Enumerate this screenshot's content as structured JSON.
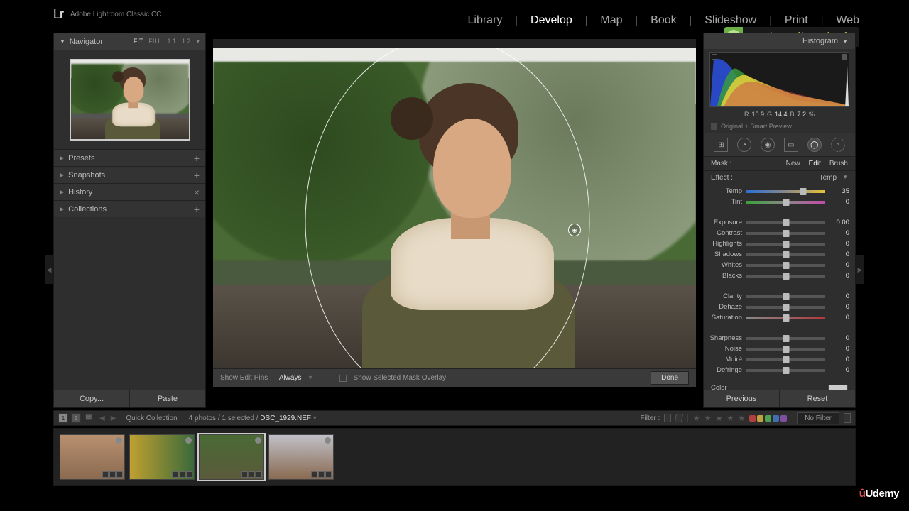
{
  "app": {
    "logo": "Lr",
    "name": "Adobe Lightroom Classic CC"
  },
  "modules": {
    "items": [
      "Library",
      "Develop",
      "Map",
      "Book",
      "Slideshow",
      "Print",
      "Web"
    ],
    "active": "Develop"
  },
  "badge": {
    "letter": "C",
    "text": "creative online school",
    "sub": "creativeonlineschool.org"
  },
  "left": {
    "navigator": "Navigator",
    "navopts": [
      "FIT",
      "FILL",
      "1:1",
      "1:2"
    ],
    "navsel": "FIT",
    "panels": [
      "Presets",
      "Snapshots",
      "History",
      "Collections"
    ],
    "copy": "Copy...",
    "paste": "Paste"
  },
  "centerbar": {
    "pins_label": "Show Edit Pins :",
    "pins_value": "Always",
    "overlay": "Show Selected Mask Overlay",
    "done": "Done"
  },
  "right": {
    "histogram": "Histogram",
    "rgb": {
      "r_label": "R",
      "r": "10.9",
      "g_label": "G",
      "g": "14.4",
      "b_label": "B",
      "b": "7.2",
      "pct": "%"
    },
    "preview": "Original + Smart Preview",
    "mask": {
      "label": "Mask :",
      "new": "New",
      "edit": "Edit",
      "brush": "Brush"
    },
    "effect": {
      "label": "Effect :",
      "value": "Temp"
    },
    "sliders": [
      {
        "label": "Temp",
        "val": "35",
        "pos": 72,
        "grad": "grad-temp"
      },
      {
        "label": "Tint",
        "val": "0",
        "pos": 50,
        "grad": "grad-tint"
      }
    ],
    "sliders2": [
      {
        "label": "Exposure",
        "val": "0.00",
        "pos": 50
      },
      {
        "label": "Contrast",
        "val": "0",
        "pos": 50
      },
      {
        "label": "Highlights",
        "val": "0",
        "pos": 50
      },
      {
        "label": "Shadows",
        "val": "0",
        "pos": 50
      },
      {
        "label": "Whites",
        "val": "0",
        "pos": 50
      },
      {
        "label": "Blacks",
        "val": "0",
        "pos": 50
      }
    ],
    "sliders3": [
      {
        "label": "Clarity",
        "val": "0",
        "pos": 50
      },
      {
        "label": "Dehaze",
        "val": "0",
        "pos": 50
      },
      {
        "label": "Saturation",
        "val": "0",
        "pos": 50,
        "grad": "grad-sat"
      }
    ],
    "sliders4": [
      {
        "label": "Sharpness",
        "val": "0",
        "pos": 50
      },
      {
        "label": "Noise",
        "val": "0",
        "pos": 50
      },
      {
        "label": "Moiré",
        "val": "0",
        "pos": 50
      },
      {
        "label": "Defringe",
        "val": "0",
        "pos": 50
      }
    ],
    "color_label": "Color",
    "previous": "Previous",
    "reset": "Reset"
  },
  "info": {
    "view1": "1",
    "view2": "2",
    "qc": "Quick Collection",
    "count": "4 photos / 1 selected /",
    "filename": "DSC_1929.NEF",
    "filter": "Filter :",
    "nofilter": "No Filter",
    "label_colors": [
      "#b04040",
      "#c0a040",
      "#50a050",
      "#4070b0",
      "#8050a0"
    ]
  },
  "udemy": "Udemy"
}
